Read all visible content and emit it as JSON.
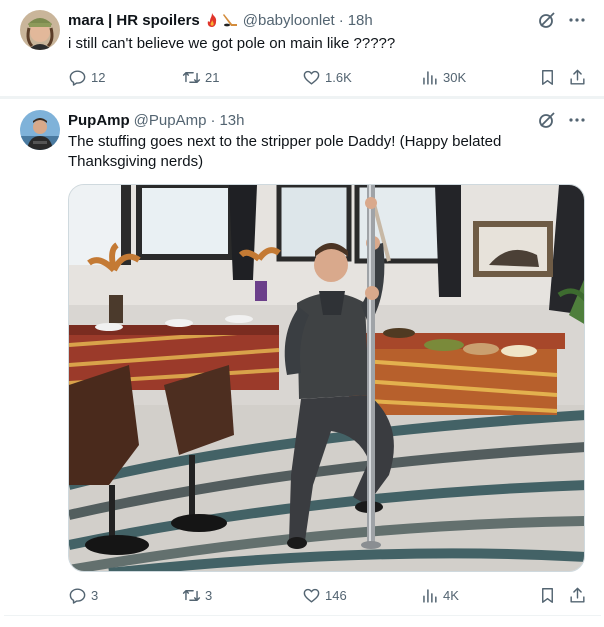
{
  "tweets": [
    {
      "display_name": "mara | HR spoilers",
      "handle": "@babyloonlet",
      "dot": "·",
      "time": "18h",
      "text": "i still can't believe we got pole on main like ?????",
      "stats": {
        "replies": "12",
        "reposts": "21",
        "likes": "1.6K",
        "views": "30K"
      }
    },
    {
      "display_name": "PupAmp",
      "handle": "@PupAmp",
      "dot": "·",
      "time": "13h",
      "text": "The stuffing goes next to the stripper pole Daddy! (Happy belated Thanksgiving nerds)",
      "stats": {
        "replies": "3",
        "reposts": "3",
        "likes": "146",
        "views": "4K"
      }
    }
  ],
  "colors": {
    "text": "#0f1419",
    "secondary": "#536471",
    "border": "#eff3f4"
  },
  "icons": [
    "grok-icon",
    "more-icon",
    "reply-icon",
    "repost-icon",
    "like-icon",
    "views-icon",
    "bookmark-icon",
    "share-icon",
    "fire-emoji-icon",
    "hockey-emoji-icon"
  ]
}
